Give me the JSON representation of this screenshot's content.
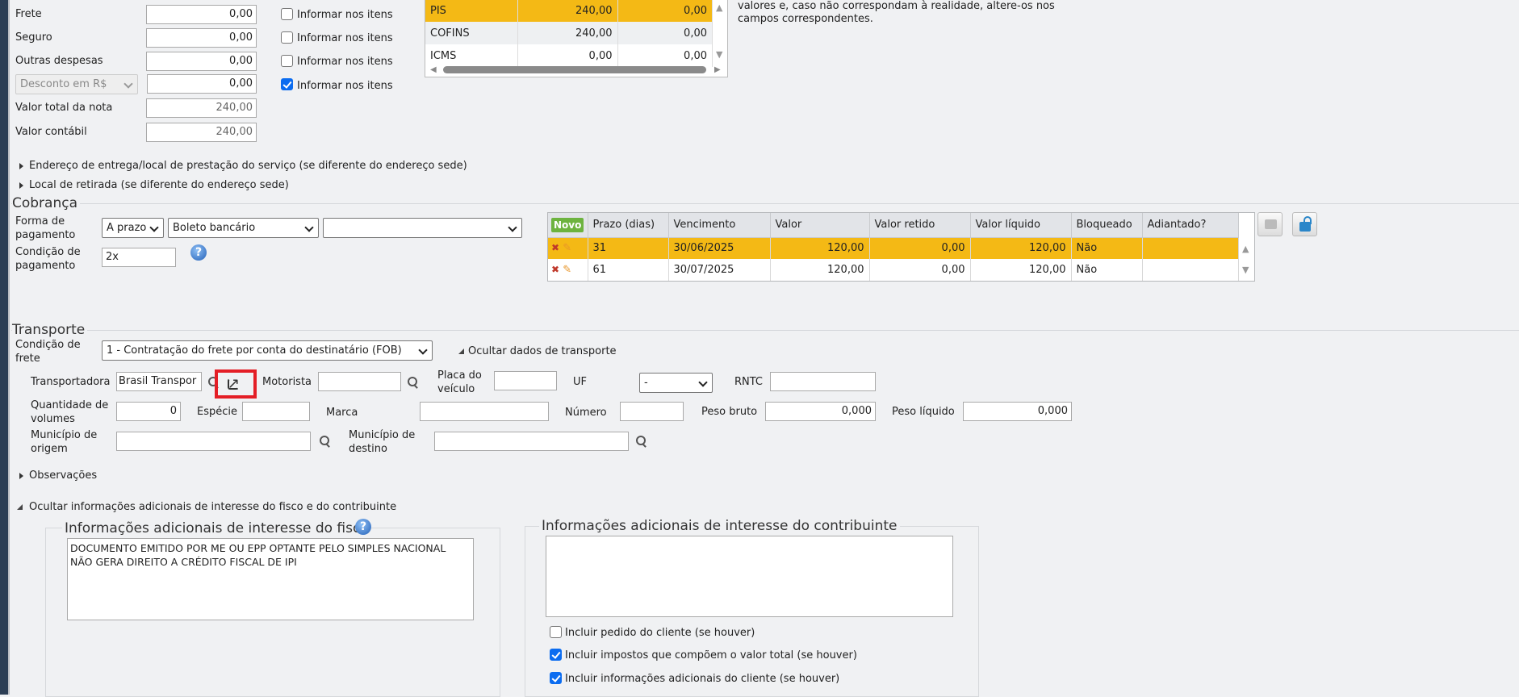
{
  "totals": {
    "rows": [
      {
        "label": "Frete",
        "value": "0,00",
        "checkbox": "Informar nos itens",
        "checked": false
      },
      {
        "label": "Seguro",
        "value": "0,00",
        "checkbox": "Informar nos itens",
        "checked": false
      },
      {
        "label": "Outras despesas",
        "value": "0,00",
        "checkbox": "Informar nos itens",
        "checked": false
      },
      {
        "label": "Desconto em R$",
        "value": "0,00",
        "checkbox": "Informar nos itens",
        "checked": true
      }
    ],
    "valor_total_label": "Valor total da nota",
    "valor_total": "240,00",
    "valor_contabil_label": "Valor contábil",
    "valor_contabil": "240,00"
  },
  "tax_table": [
    {
      "name": "PIS",
      "base": "240,00",
      "value": "0,00"
    },
    {
      "name": "COFINS",
      "base": "240,00",
      "value": "0,00"
    },
    {
      "name": "ICMS",
      "base": "0,00",
      "value": "0,00"
    }
  ],
  "notice": {
    "line1": "valores e, caso não correspondam à realidade, altere-os nos",
    "line2": "campos correspondentes."
  },
  "collapsibles": {
    "endereco": "Endereço de entrega/local de prestação do serviço (se diferente do endereço sede)",
    "retirada": "Local de retirada (se diferente do endereço sede)",
    "observacoes": "Observações",
    "ocultar_info": "Ocultar informações adicionais de interesse do fisco e do contribuinte"
  },
  "cobranca": {
    "legend": "Cobrança",
    "forma_label1": "Forma de",
    "forma_label2": "pagamento",
    "forma_value": "A prazo",
    "meio_value": "Boleto bancário",
    "extra_value": "",
    "condicao_label1": "Condição de",
    "condicao_label2": "pagamento",
    "condicao_value": "2x",
    "novo_label": "Novo",
    "columns": [
      "Prazo (dias)",
      "Vencimento",
      "Valor",
      "Valor retido",
      "Valor líquido",
      "Bloqueado",
      "Adiantado?"
    ],
    "rows": [
      {
        "prazo": "31",
        "vencimento": "30/06/2025",
        "valor": "120,00",
        "retido": "0,00",
        "liquido": "120,00",
        "bloqueado": "Não",
        "adiantado": ""
      },
      {
        "prazo": "61",
        "vencimento": "30/07/2025",
        "valor": "120,00",
        "retido": "0,00",
        "liquido": "120,00",
        "bloqueado": "Não",
        "adiantado": ""
      }
    ]
  },
  "transporte": {
    "legend": "Transporte",
    "condicao_label1": "Condição de",
    "condicao_label2": "frete",
    "condicao_value": "1 - Contratação do frete por conta do destinatário (FOB)",
    "ocultar_label": "Ocultar dados de transporte",
    "transportadora_label": "Transportadora",
    "transportadora_value": "Brasil Transpor",
    "motorista_label": "Motorista",
    "motorista_value": "",
    "placa_label1": "Placa do",
    "placa_label2": "veículo",
    "placa_value": "",
    "uf_label": "UF",
    "uf_value": "-",
    "rntc_label": "RNTC",
    "rntc_value": "",
    "qtd_label1": "Quantidade de",
    "qtd_label2": "volumes",
    "qtd_value": "0",
    "especie_label": "Espécie",
    "especie_value": "",
    "marca_label": "Marca",
    "marca_value": "",
    "numero_label": "Número",
    "numero_value": "",
    "peso_bruto_label": "Peso bruto",
    "peso_bruto_value": "0,000",
    "peso_liquido_label": "Peso líquido",
    "peso_liquido_value": "0,000",
    "origem_label1": "Município de",
    "origem_label2": "origem",
    "origem_value": "",
    "destino_label1": "Município de",
    "destino_label2": "destino",
    "destino_value": ""
  },
  "info_fisco": {
    "legend": "Informações adicionais de interesse do fisco",
    "text": "DOCUMENTO EMITIDO POR ME OU EPP OPTANTE PELO SIMPLES NACIONAL NÃO GERA DIREITO A CRÉDITO FISCAL DE IPI"
  },
  "info_contribuinte": {
    "legend": "Informações adicionais de interesse do contribuinte",
    "text": "",
    "options": [
      {
        "label": "Incluir pedido do cliente (se houver)",
        "checked": false
      },
      {
        "label": "Incluir impostos que compõem o valor total (se houver)",
        "checked": true
      },
      {
        "label": "Incluir informações adicionais do cliente (se houver)",
        "checked": true
      }
    ]
  },
  "colors": {
    "highlight": "#f4b915",
    "novo": "#6db33f",
    "annotation": "#e41e26"
  }
}
